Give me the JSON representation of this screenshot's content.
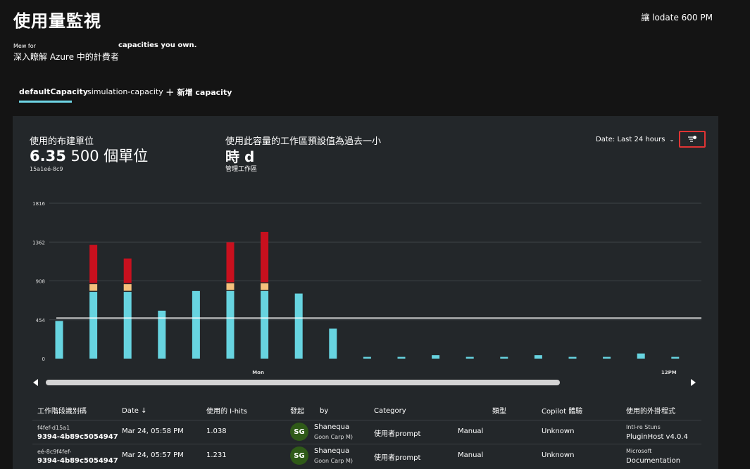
{
  "header": {
    "title": "使用量監視",
    "update_text": "讓 lodate 600 PM",
    "subtitle_small": "Mew for",
    "subtitle_bold": "capacities you own.",
    "subtitle_line2": "深入瞭解 Azure 中的計費者"
  },
  "tabs": [
    {
      "label": "defaultCapacity",
      "active": true
    },
    {
      "label": "simulation-capacity",
      "active": false
    },
    {
      "label": "新增 capacity",
      "icon": "plus-icon"
    }
  ],
  "metrics": {
    "used_units_label": "使用的布建單位",
    "used_units_value": "6.35",
    "used_units_total": "500 個單位",
    "capacity_id": "15a1eé-8c9",
    "workspace_label": "使用此容量的工作區預設值為過去一小",
    "workspace_value": "時 d",
    "workspace_sub": "管理工作區"
  },
  "filter": {
    "date_label": "Date: Last 24 hours",
    "filter_icon": "filter-settings-icon"
  },
  "chart_data": {
    "type": "bar",
    "yticks": [
      0,
      454,
      908,
      1362,
      1816
    ],
    "ylim": [
      0,
      1816
    ],
    "x_labels": [
      {
        "index": 6,
        "label": "Mon"
      },
      {
        "index": 18,
        "label": "12PM"
      }
    ],
    "reference_line": 475,
    "colors": {
      "base": "#67d4e0",
      "mid": "#f5c07c",
      "top": "#c8101e",
      "line": "#ffffff",
      "grid": "#3e4347"
    },
    "series": [
      {
        "name": "base",
        "values": [
          440,
          780,
          780,
          560,
          790,
          790,
          790,
          760,
          350,
          20,
          20,
          40,
          20,
          20,
          40,
          20,
          20,
          60,
          20
        ]
      },
      {
        "name": "mid",
        "values": [
          0,
          90,
          90,
          0,
          0,
          90,
          90,
          0,
          0,
          0,
          0,
          0,
          0,
          0,
          0,
          0,
          0,
          0,
          0
        ]
      },
      {
        "name": "top",
        "values": [
          0,
          460,
          300,
          0,
          0,
          480,
          600,
          0,
          0,
          0,
          0,
          0,
          0,
          0,
          0,
          0,
          0,
          0,
          0
        ]
      }
    ]
  },
  "table": {
    "headers": [
      "工作階段識別碼",
      "Date",
      "使用的 I-hits",
      "發起",
      "by",
      "Category",
      "類型",
      "Copilot 體驗",
      "使用的外掛程式"
    ],
    "rows": [
      {
        "id_line1": "f4fef-d15a1",
        "id_line2": "9394-4b89c5054947",
        "date": "Mar 24, 05:58 PM",
        "units": "1.038",
        "avatar": "SG",
        "user_name": "Shanequa",
        "user_org": "Goon Carp M)",
        "category": "使用者prompt",
        "type": "Manual",
        "experience": "Unknown",
        "plugin_line1": "Intl-re Stuns",
        "plugin_line2": "PluginHost v4.0.4"
      },
      {
        "id_line1": "eé-8c9f4fef-",
        "id_line2": "9394-4b89c5054947",
        "date": "Mar 24, 05:57 PM",
        "units": "1.231",
        "avatar": "SG",
        "user_name": "Shanequa",
        "user_org": "Goon Carp M)",
        "category": "使用者prompt",
        "type": "Manual",
        "experience": "Unknown",
        "plugin_line1": "Microsoft",
        "plugin_line2": "Documentation"
      }
    ]
  }
}
